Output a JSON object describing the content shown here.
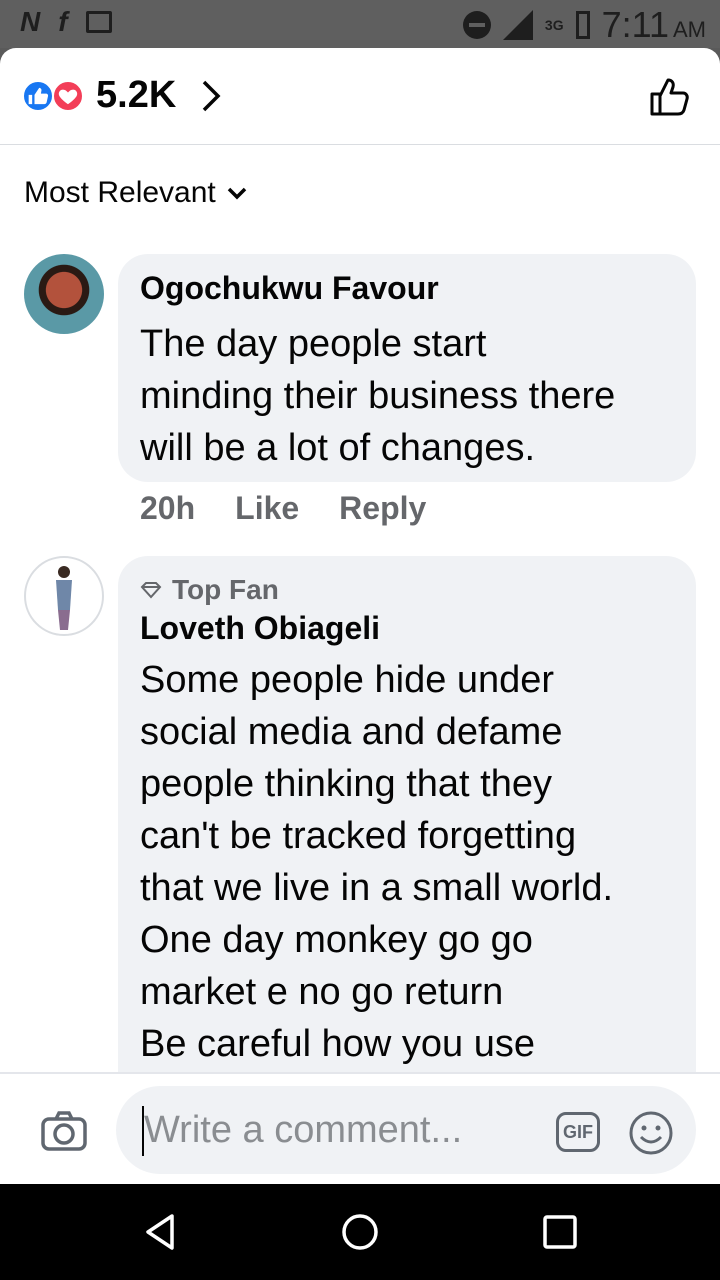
{
  "status_bar": {
    "time": "7:11",
    "ampm": "AM",
    "network": "3G",
    "icons": [
      "netflix-icon",
      "facebook-icon",
      "gallery-icon",
      "dnd-icon",
      "signal-icon",
      "battery-icon"
    ]
  },
  "header": {
    "reaction_count": "5.2K",
    "reaction_icons": [
      "like-reaction-icon",
      "love-reaction-icon"
    ]
  },
  "sort": {
    "label": "Most Relevant"
  },
  "comments": [
    {
      "author": "Ogochukwu Favour",
      "lines": [
        "The day people start",
        "minding their business there",
        "will be a lot of changes."
      ],
      "time": "20h",
      "like_label": "Like",
      "reply_label": "Reply"
    },
    {
      "badge": "Top Fan",
      "author": "Loveth Obiageli",
      "lines": [
        "Some people hide under",
        "social media and defame",
        "people thinking that they",
        "can't be tracked forgetting",
        "that we live in a small world.",
        "One day monkey go go",
        "market e no go return",
        "Be careful how you use"
      ]
    }
  ],
  "composer": {
    "placeholder": "Write a comment...",
    "gif_label": "GIF"
  },
  "colors": {
    "accent": "#1877f2",
    "love": "#f33e58",
    "bubble": "#f0f2f5",
    "meta": "#65676b"
  }
}
